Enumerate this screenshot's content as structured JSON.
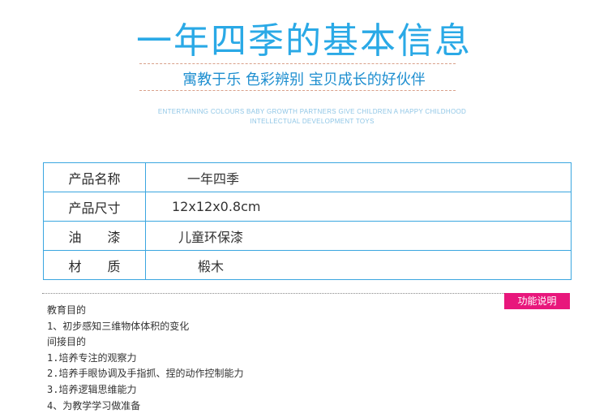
{
  "header": {
    "title": "一年四季的基本信息",
    "slogan": "寓教于乐  色彩辨别  宝贝成长的好伙伴",
    "english_line1": "ENTERTAINING COLOURS BABY GROWTH PARTNERS GIVE CHILDREN A HAPPY CHILDHOOD",
    "english_line2": "INTELLECTUAL DEVELOPMENT TOYS"
  },
  "specs": [
    {
      "label": "产品名称",
      "value": "一年四季"
    },
    {
      "label": "产品尺寸",
      "value": "12x12x0.8cm"
    },
    {
      "label": "油　　漆",
      "value": "儿童环保漆"
    },
    {
      "label": "材　　质",
      "value": "椴木"
    }
  ],
  "badge": "功能说明",
  "description": [
    "教育目的",
    "1、初步感知三维物体体积的变化",
    "间接目的",
    "1.培养专注的观察力",
    "2.培养手眼协调及手指抓、捏的动作控制能力",
    "3.培养逻辑思维能力",
    "4、为教学学习做准备"
  ],
  "colors": {
    "title": "#2aa9e6",
    "slogan": "#1f8fd0",
    "table_border": "#3aa6e0",
    "badge_bg": "#e8177c"
  }
}
